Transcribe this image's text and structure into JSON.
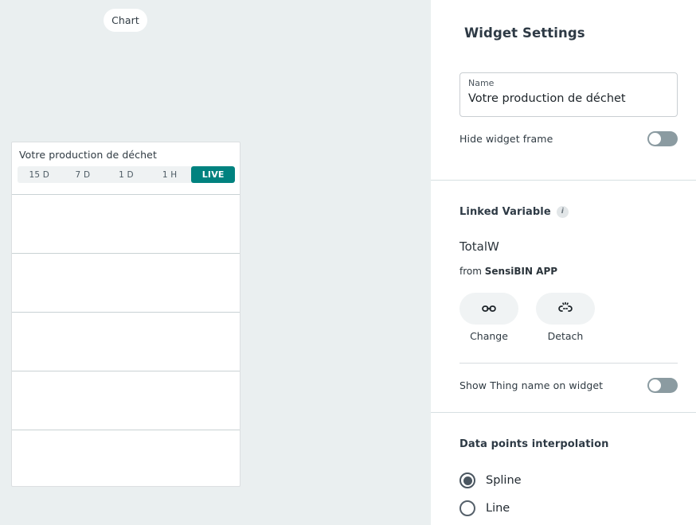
{
  "canvas": {
    "chart_pill_label": "Chart",
    "widget": {
      "title": "Votre production de déchet",
      "ranges": [
        {
          "label": "15 D",
          "active": false
        },
        {
          "label": "7 D",
          "active": false
        },
        {
          "label": "1 D",
          "active": false
        },
        {
          "label": "1 H",
          "active": false
        },
        {
          "label": "LIVE",
          "active": true
        }
      ]
    }
  },
  "panel": {
    "title": "Widget Settings",
    "name_field": {
      "label": "Name",
      "value": "Votre production de déchet"
    },
    "hide_widget_frame": {
      "label": "Hide widget frame",
      "state": "off"
    },
    "linked_variable": {
      "heading": "Linked Variable",
      "info_icon_glyph": "i",
      "variable_name": "TotalW",
      "from_prefix": "from ",
      "from_source": "SensiBIN APP",
      "actions": [
        {
          "icon": "link-icon",
          "label": "Change"
        },
        {
          "icon": "link-off-icon",
          "label": "Detach"
        }
      ]
    },
    "show_thing_name": {
      "label": "Show Thing name on widget",
      "state": "off"
    },
    "interpolation": {
      "heading": "Data points interpolation",
      "options": [
        {
          "label": "Spline",
          "selected": true
        },
        {
          "label": "Line",
          "selected": false
        }
      ]
    }
  },
  "colors": {
    "canvas_bg": "#eaeff0",
    "accent_teal": "#00827f",
    "toggle_track": "#8b9ba1",
    "radio_selected": "#4a5660",
    "gridline": "#c9d2d4"
  },
  "chart_data": {
    "type": "line",
    "title": "Votre production de déchet",
    "series": [],
    "x": [],
    "categories": [],
    "values": [],
    "xlabel": "",
    "ylabel": "",
    "grid": true,
    "gridline_count": 5,
    "note": "empty plot area - no data points rendered"
  }
}
